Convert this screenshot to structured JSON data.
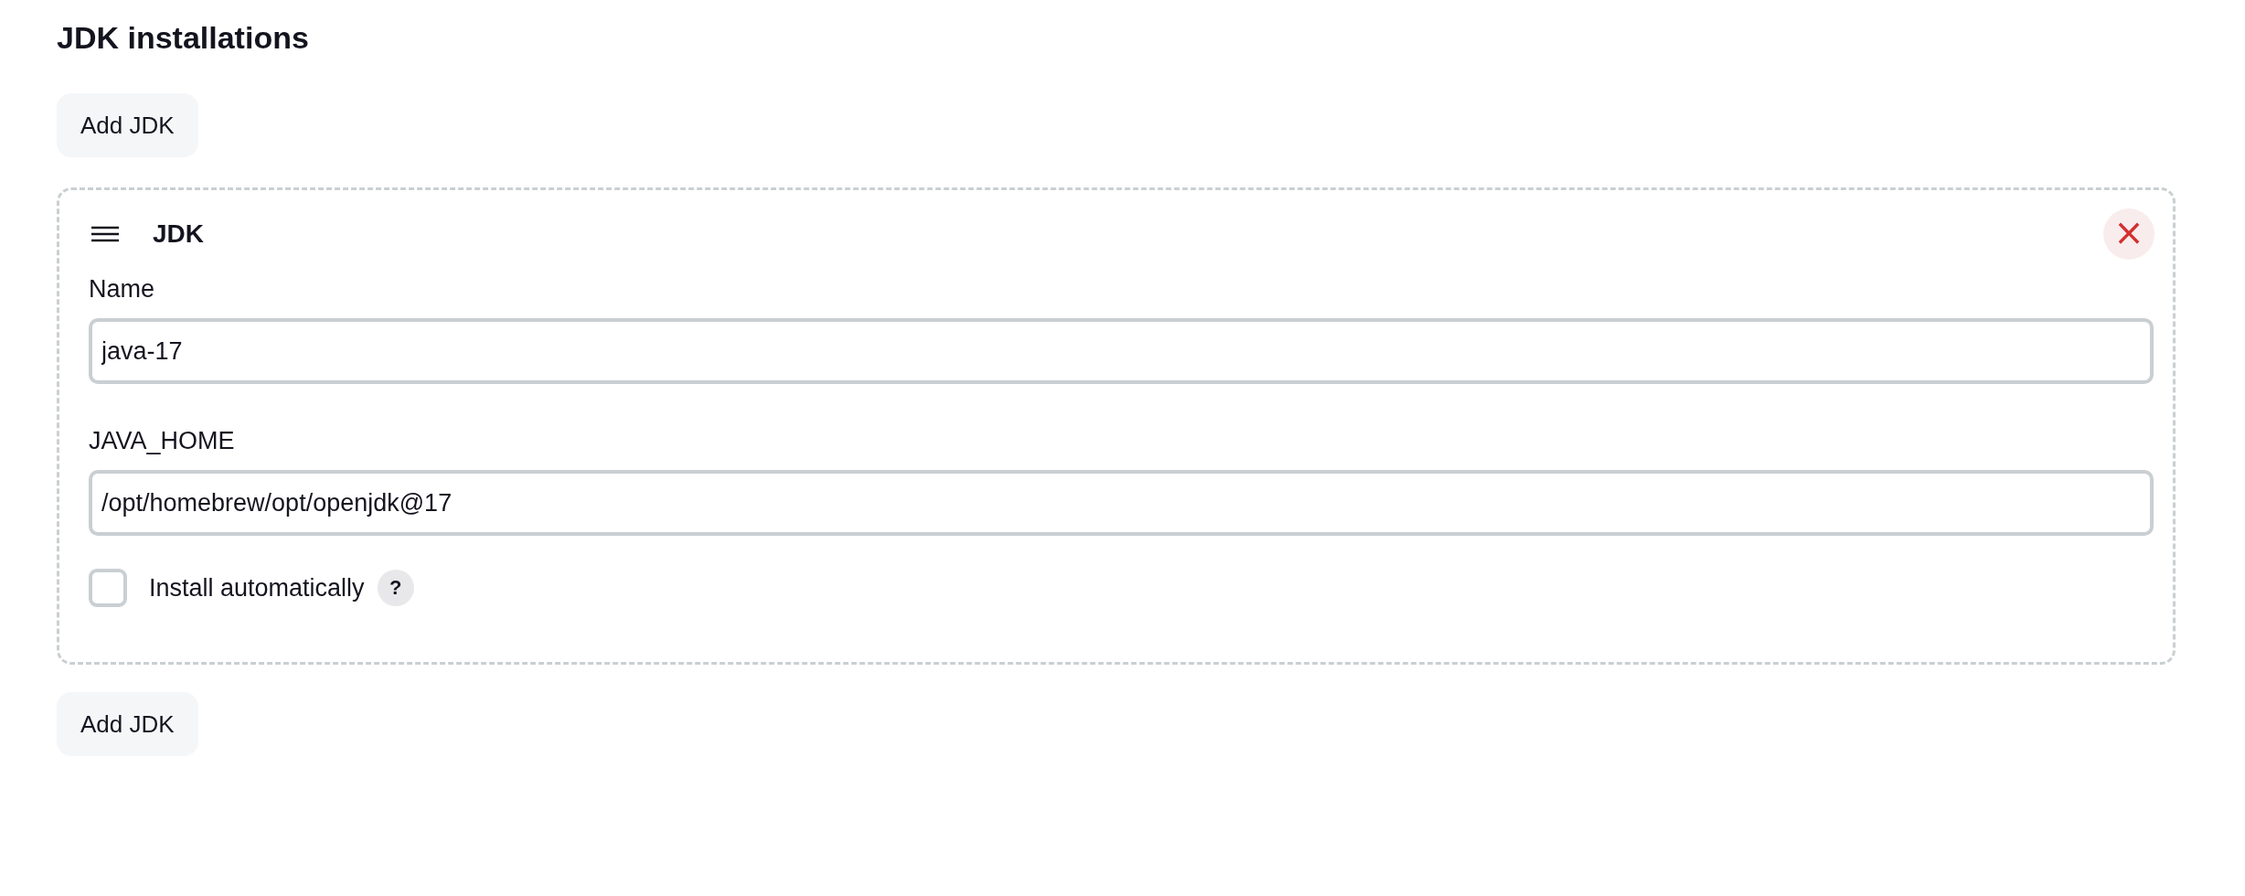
{
  "heading": "JDK installations",
  "add_button_top": "Add JDK",
  "installations": [
    {
      "title": "JDK",
      "remove_symbol": "×",
      "fields": [
        {
          "label": "Name",
          "value": "java-17"
        },
        {
          "label": "JAVA_HOME",
          "value": "/opt/homebrew/opt/openjdk@17"
        }
      ],
      "install_automatically": {
        "label": "Install automatically",
        "checked": false,
        "help": "?"
      }
    }
  ],
  "add_button_bottom": "Add JDK"
}
